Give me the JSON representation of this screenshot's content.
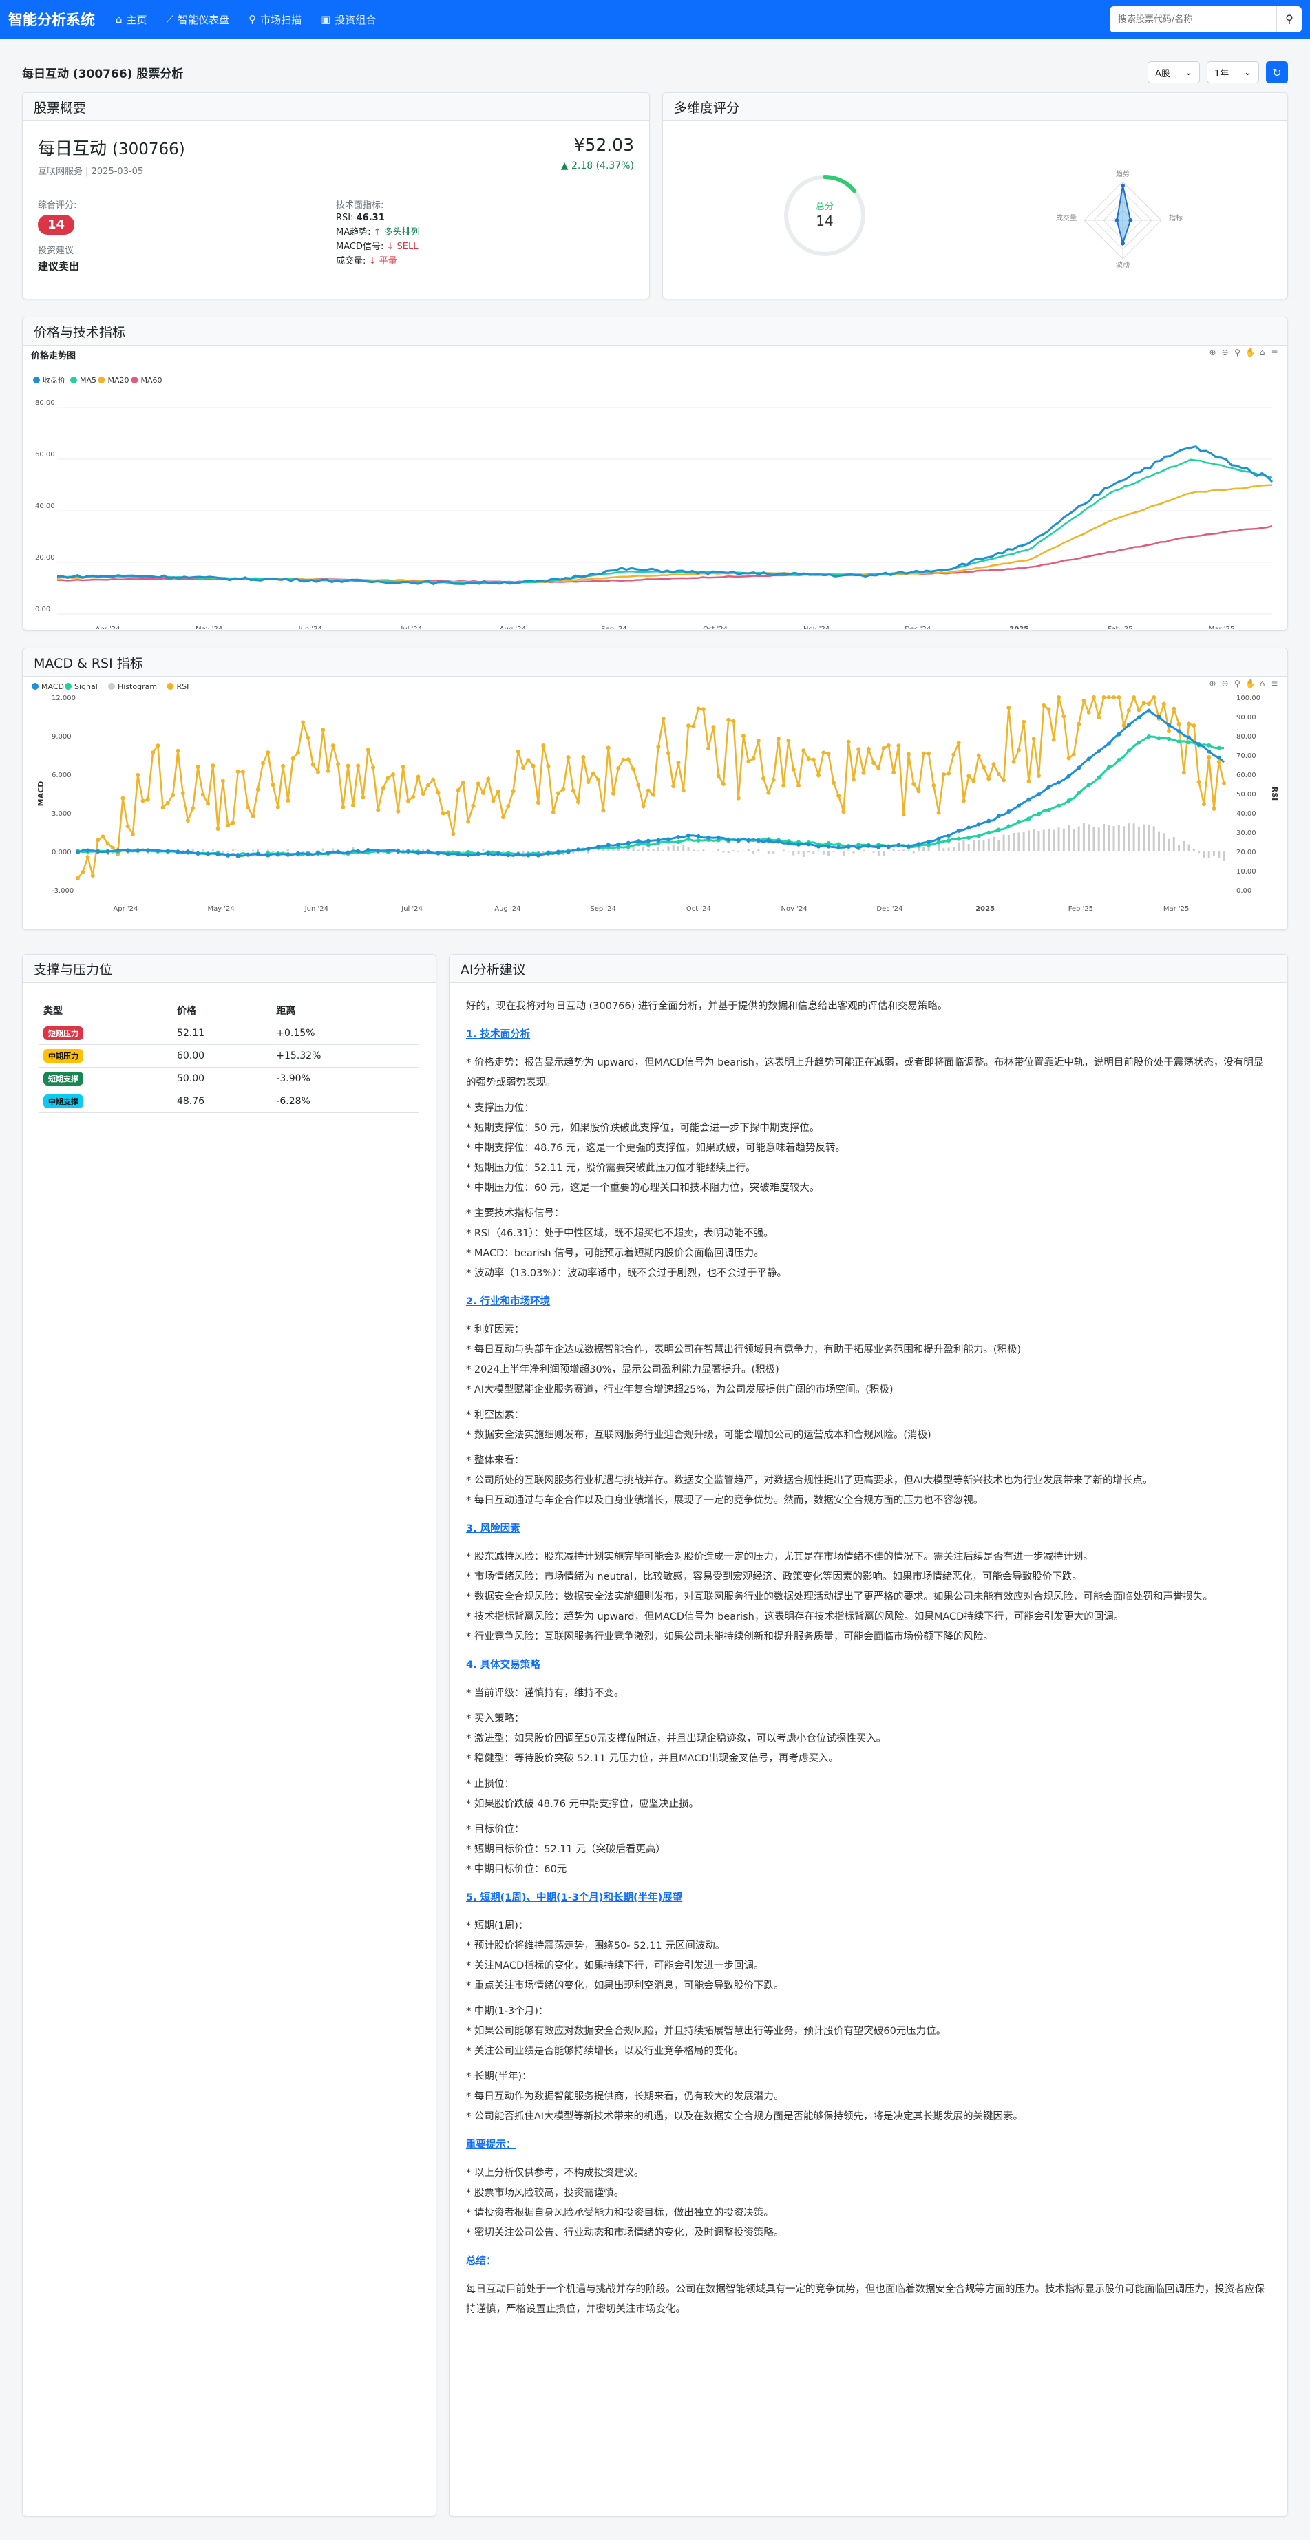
{
  "nav": {
    "brand": "智能分析系统",
    "links": [
      {
        "label": "主页",
        "icon": "home-icon"
      },
      {
        "label": "智能仪表盘",
        "icon": "chart-line-icon"
      },
      {
        "label": "市场扫描",
        "icon": "search-icon"
      },
      {
        "label": "投资组合",
        "icon": "briefcase-icon"
      }
    ],
    "search_placeholder": "搜索股票代码/名称"
  },
  "title": "每日互动 (300766) 股票分析",
  "controls": {
    "market": "A股",
    "period": "1年"
  },
  "overview": {
    "header": "股票概要",
    "name": "每日互动",
    "code": "(300766)",
    "sub": "互联网服务 | 2025-03-05",
    "price": "¥52.03",
    "change": "2.18 (4.37%)",
    "score_label": "综合评分:",
    "score": "14",
    "advice_label": "投资建议",
    "advice": "建议卖出",
    "tech_label": "技术面指标:",
    "rsi_label": "RSI:",
    "rsi": "46.31",
    "ma_label": "MA趋势:",
    "ma": "多头排列",
    "macd_label": "MACD信号:",
    "macd": "SELL",
    "vol_label": "成交量:",
    "vol": "平量"
  },
  "radar": {
    "header": "多维度评分",
    "center_label": "总分",
    "center_value": "14",
    "axes": [
      "趋势",
      "指标",
      "波动",
      "成交量"
    ],
    "values": [
      0.9,
      0.2,
      0.6,
      0.15
    ],
    "gauge_fraction": 0.14
  },
  "price_chart": {
    "header": "价格与技术指标",
    "title": "价格走势图"
  },
  "macd_chart": {
    "header": "MACD & RSI 指标"
  },
  "chart_data": [
    {
      "type": "line",
      "title": "价格走势图",
      "x": [
        "Apr '24",
        "May '24",
        "Jun '24",
        "Jul '24",
        "Aug '24",
        "Sep '24",
        "Oct '24",
        "Nov '24",
        "Dec '24",
        "2025",
        "Feb '25",
        "Mar '25"
      ],
      "ylim": [
        0,
        80
      ],
      "yticks": [
        "0.00",
        "20.00",
        "40.00",
        "60.00",
        "80.00"
      ],
      "legend": "top-left",
      "series": [
        {
          "name": "收盘价",
          "color": "#1e90d6",
          "values": [
            14.5,
            14.8,
            13.8,
            13.2,
            12.5,
            12.0,
            12.5,
            17.5,
            16.0,
            15.5,
            14.8,
            17.5,
            27.0,
            50.0,
            65.0,
            52.0
          ]
        },
        {
          "name": "MA5",
          "color": "#1fd2a0",
          "values": [
            14.4,
            14.6,
            13.9,
            13.3,
            12.6,
            12.1,
            12.4,
            16.5,
            16.2,
            15.6,
            15.0,
            17.0,
            25.0,
            47.0,
            60.0,
            53.0
          ]
        },
        {
          "name": "MA20",
          "color": "#f0b429",
          "values": [
            14.0,
            14.4,
            14.0,
            13.5,
            12.9,
            12.3,
            12.3,
            14.5,
            15.7,
            15.8,
            15.2,
            16.0,
            21.0,
            36.0,
            47.0,
            50.0
          ]
        },
        {
          "name": "MA60",
          "color": "#e05c7e",
          "values": [
            13.0,
            13.6,
            13.7,
            13.5,
            13.1,
            12.6,
            12.4,
            13.0,
            14.2,
            15.0,
            15.4,
            15.8,
            18.0,
            24.0,
            30.0,
            34.0
          ]
        }
      ]
    },
    {
      "type": "line",
      "title": "MACD & RSI 指标",
      "x": [
        "Apr '24",
        "May '24",
        "Jun '24",
        "Jul '24",
        "Aug '24",
        "Sep '24",
        "Oct '24",
        "Nov '24",
        "Dec '24",
        "2025",
        "Feb '25",
        "Mar '25"
      ],
      "ylim": [
        -3,
        12
      ],
      "yticks": [
        "-3.000",
        "0.000",
        "3.000",
        "6.000",
        "9.000",
        "12.000"
      ],
      "ylabel": "MACD",
      "y2lim": [
        0,
        100
      ],
      "y2ticks": [
        "0.00",
        "10.00",
        "20.00",
        "30.00",
        "40.00",
        "50.00",
        "60.00",
        "70.00",
        "80.00",
        "90.00",
        "100.00"
      ],
      "y2label": "RSI",
      "legend": "top-left",
      "series": [
        {
          "name": "MACD",
          "color": "#1e90d6",
          "values": [
            0,
            0.1,
            -0.3,
            -0.2,
            0.1,
            -0.2,
            -0.3,
            0.5,
            1.2,
            0.8,
            0.3,
            0.5,
            2.5,
            6.0,
            11.0,
            7.0
          ]
        },
        {
          "name": "Signal",
          "color": "#1fd2a0",
          "values": [
            0,
            0.05,
            -0.2,
            -0.2,
            0,
            -0.1,
            -0.2,
            0.3,
            0.9,
            0.9,
            0.5,
            0.4,
            1.5,
            4.0,
            9.0,
            8.0
          ]
        },
        {
          "name": "Histogram",
          "color": "#cccccc",
          "values": [
            0,
            0.05,
            -0.1,
            0,
            0.1,
            -0.1,
            -0.1,
            0.2,
            0.3,
            -0.1,
            -0.2,
            0.1,
            1.0,
            2.0,
            2.0,
            -1.0
          ]
        },
        {
          "name": "RSI",
          "color": "#f0b429",
          "values": [
            0,
            60,
            45,
            70,
            50,
            40,
            60,
            55,
            75,
            65,
            60,
            55,
            70,
            90,
            95,
            50
          ]
        }
      ]
    }
  ],
  "support": {
    "header": "支撑与压力位",
    "cols": [
      "类型",
      "价格",
      "距离"
    ],
    "rows": [
      {
        "type": "短期压力",
        "color": "#dc3545",
        "price": "52.11",
        "dist": "+0.15%"
      },
      {
        "type": "中期压力",
        "color": "#ffc107",
        "price": "60.00",
        "dist": "+15.32%"
      },
      {
        "type": "短期支撑",
        "color": "#198754",
        "price": "50.00",
        "dist": "-3.90%"
      },
      {
        "type": "中期支撑",
        "color": "#0dcaf0",
        "price": "48.76",
        "dist": "-6.28%"
      }
    ]
  },
  "ai": {
    "header": "AI分析建议",
    "lines": [
      {
        "t": "p",
        "text": "好的，现在我将对每日互动 (300766) 进行全面分析，并基于提供的数据和信息给出客观的评估和交易策略。"
      },
      {
        "t": "h",
        "text": "1. 技术面分析"
      },
      {
        "t": "p",
        "text": "* 价格走势：报告显示趋势为 upward，但MACD信号为 bearish，这表明上升趋势可能正在减弱，或者即将面临调整。布林带位置靠近中轨，说明目前股价处于震荡状态，没有明显的强势或弱势表现。"
      },
      {
        "t": "p",
        "text": "* 支撑压力位："
      },
      {
        "t": "p",
        "text": "* 短期支撑位：50 元，如果股价跌破此支撑位，可能会进一步下探中期支撑位。"
      },
      {
        "t": "p",
        "text": "* 中期支撑位：48.76 元，这是一个更强的支撑位，如果跌破，可能意味着趋势反转。"
      },
      {
        "t": "p",
        "text": "* 短期压力位：52.11 元，股价需要突破此压力位才能继续上行。"
      },
      {
        "t": "p",
        "text": "* 中期压力位：60 元，这是一个重要的心理关口和技术阻力位，突破难度较大。"
      },
      {
        "t": "p",
        "text": "* 主要技术指标信号："
      },
      {
        "t": "p",
        "text": "* RSI（46.31）：处于中性区域，既不超买也不超卖，表明动能不强。"
      },
      {
        "t": "p",
        "text": "* MACD：bearish 信号，可能预示着短期内股价会面临回调压力。"
      },
      {
        "t": "p",
        "text": "* 波动率（13.03%）：波动率适中，既不会过于剧烈，也不会过于平静。"
      },
      {
        "t": "h",
        "text": "2. 行业和市场环境"
      },
      {
        "t": "p",
        "text": "* 利好因素："
      },
      {
        "t": "p",
        "text": "* 每日互动与头部车企达成数据智能合作，表明公司在智慧出行领域具有竞争力，有助于拓展业务范围和提升盈利能力。(积极)"
      },
      {
        "t": "p",
        "text": "* 2024上半年净利润预增超30%，显示公司盈利能力显著提升。(积极)"
      },
      {
        "t": "p",
        "text": "* AI大模型赋能企业服务赛道，行业年复合增速超25%，为公司发展提供广阔的市场空间。(积极)"
      },
      {
        "t": "p",
        "text": "* 利空因素："
      },
      {
        "t": "p",
        "text": "* 数据安全法实施细则发布，互联网服务行业迎合规升级，可能会增加公司的运营成本和合规风险。(消极)"
      },
      {
        "t": "p",
        "text": "* 整体来看："
      },
      {
        "t": "p",
        "text": "* 公司所处的互联网服务行业机遇与挑战并存。数据安全监管趋严，对数据合规性提出了更高要求，但AI大模型等新兴技术也为行业发展带来了新的增长点。"
      },
      {
        "t": "p",
        "text": "* 每日互动通过与车企合作以及自身业绩增长，展现了一定的竞争优势。然而，数据安全合规方面的压力也不容忽视。"
      },
      {
        "t": "h",
        "text": "3. 风险因素"
      },
      {
        "t": "p",
        "text": "* 股东减持风险：股东减持计划实施完毕可能会对股价造成一定的压力，尤其是在市场情绪不佳的情况下。需关注后续是否有进一步减持计划。"
      },
      {
        "t": "p",
        "text": "* 市场情绪风险：市场情绪为 neutral，比较敏感，容易受到宏观经济、政策变化等因素的影响。如果市场情绪恶化，可能会导致股价下跌。"
      },
      {
        "t": "p",
        "text": "* 数据安全合规风险：数据安全法实施细则发布，对互联网服务行业的数据处理活动提出了更严格的要求。如果公司未能有效应对合规风险，可能会面临处罚和声誉损失。"
      },
      {
        "t": "p",
        "text": "* 技术指标背离风险：趋势为 upward，但MACD信号为 bearish，这表明存在技术指标背离的风险。如果MACD持续下行，可能会引发更大的回调。"
      },
      {
        "t": "p",
        "text": "* 行业竞争风险：互联网服务行业竞争激烈，如果公司未能持续创新和提升服务质量，可能会面临市场份额下降的风险。"
      },
      {
        "t": "h",
        "text": "4. 具体交易策略"
      },
      {
        "t": "p",
        "text": "* 当前评级：谨慎持有，维持不变。"
      },
      {
        "t": "p",
        "text": "* 买入策略："
      },
      {
        "t": "p",
        "text": "* 激进型：如果股价回调至50元支撑位附近，并且出现企稳迹象，可以考虑小仓位试探性买入。"
      },
      {
        "t": "p",
        "text": "* 稳健型：等待股价突破 52.11 元压力位，并且MACD出现金叉信号，再考虑买入。"
      },
      {
        "t": "p",
        "text": "* 止损位："
      },
      {
        "t": "p",
        "text": "* 如果股价跌破 48.76 元中期支撑位，应坚决止损。"
      },
      {
        "t": "p",
        "text": "* 目标价位："
      },
      {
        "t": "p",
        "text": "* 短期目标价位：52.11 元（突破后看更高）"
      },
      {
        "t": "p",
        "text": "* 中期目标价位：60元"
      },
      {
        "t": "h",
        "text": "5. 短期(1周)、中期(1-3个月)和长期(半年)展望"
      },
      {
        "t": "p",
        "text": "* 短期(1周)："
      },
      {
        "t": "p",
        "text": "* 预计股价将维持震荡走势，围绕50- 52.11 元区间波动。"
      },
      {
        "t": "p",
        "text": "* 关注MACD指标的变化，如果持续下行，可能会引发进一步回调。"
      },
      {
        "t": "p",
        "text": "* 重点关注市场情绪的变化，如果出现利空消息，可能会导致股价下跌。"
      },
      {
        "t": "p",
        "text": "* 中期(1-3个月)："
      },
      {
        "t": "p",
        "text": "* 如果公司能够有效应对数据安全合规风险，并且持续拓展智慧出行等业务，预计股价有望突破60元压力位。"
      },
      {
        "t": "p",
        "text": "* 关注公司业绩是否能够持续增长，以及行业竞争格局的变化。"
      },
      {
        "t": "p",
        "text": "* 长期(半年)："
      },
      {
        "t": "p",
        "text": "* 每日互动作为数据智能服务提供商，长期来看，仍有较大的发展潜力。"
      },
      {
        "t": "p",
        "text": "* 公司能否抓住AI大模型等新技术带来的机遇，以及在数据安全合规方面是否能够保持领先，将是决定其长期发展的关键因素。"
      },
      {
        "t": "h",
        "text": "重要提示："
      },
      {
        "t": "p",
        "text": "* 以上分析仅供参考，不构成投资建议。"
      },
      {
        "t": "p",
        "text": "* 股票市场风险较高，投资需谨慎。"
      },
      {
        "t": "p",
        "text": "* 请投资者根据自身风险承受能力和投资目标，做出独立的投资决策。"
      },
      {
        "t": "p",
        "text": "* 密切关注公司公告、行业动态和市场情绪的变化，及时调整投资策略。"
      },
      {
        "t": "h",
        "text": "总结："
      },
      {
        "t": "p",
        "text": "每日互动目前处于一个机遇与挑战并存的阶段。公司在数据智能领域具有一定的竞争优势，但也面临着数据安全合规等方面的压力。技术指标显示股价可能面临回调压力，投资者应保持谨慎，严格设置止损位，并密切关注市场变化。"
      }
    ]
  }
}
